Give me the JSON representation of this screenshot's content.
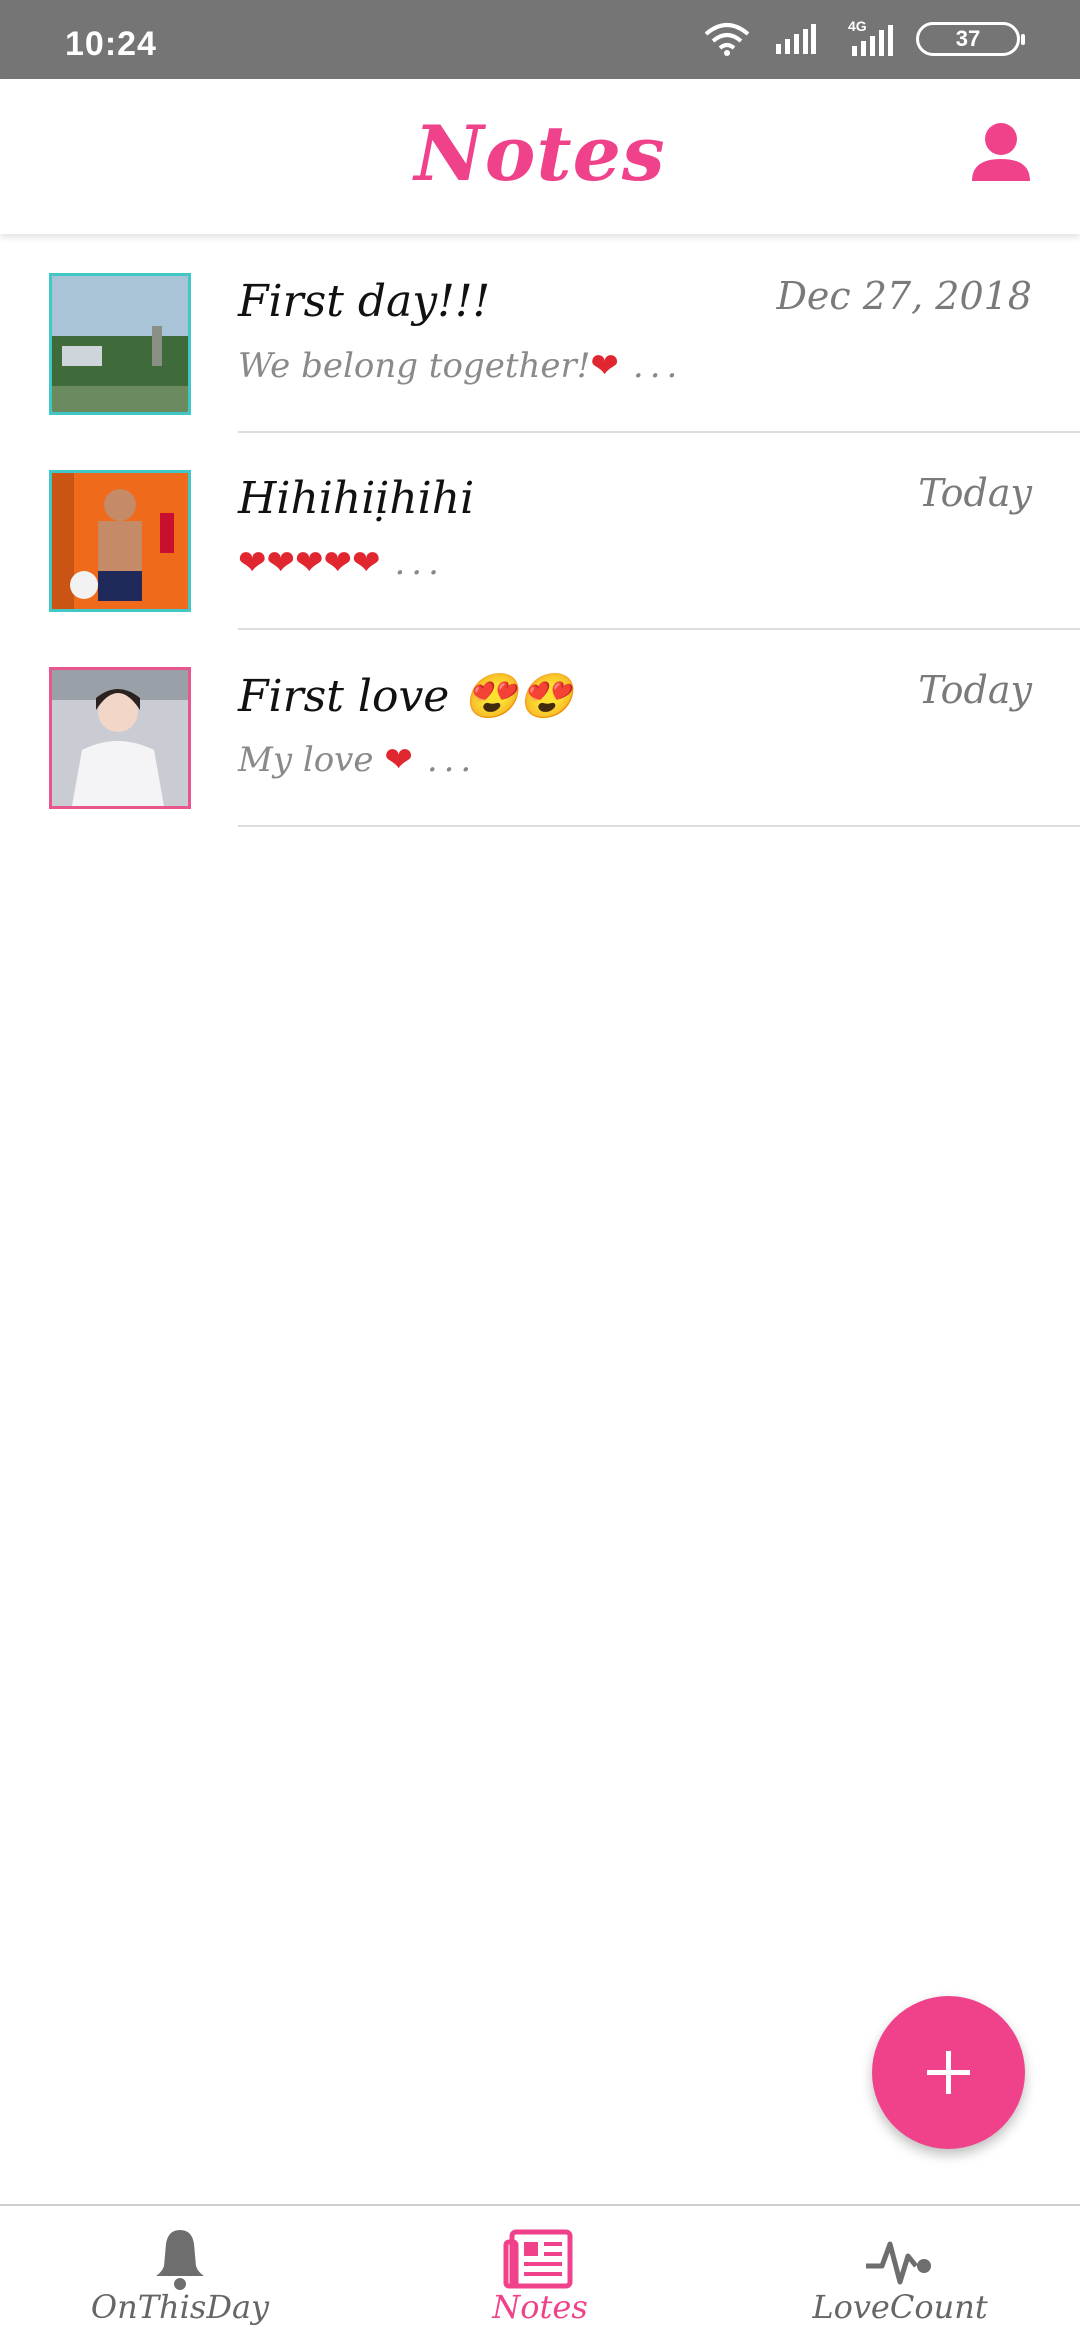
{
  "status_bar": {
    "time": "10:24",
    "network": "4G",
    "battery": "37"
  },
  "app_bar": {
    "title": "Notes"
  },
  "notes": [
    {
      "title": "First day!!!",
      "date": "Dec 27, 2018",
      "preview_text": "We belong together!",
      "preview_hearts": "❤",
      "ellipsis": "..."
    },
    {
      "title": "Hihihiịhihi",
      "date": "Today",
      "preview_text": "",
      "preview_hearts": "❤❤❤❤❤",
      "ellipsis": "..."
    },
    {
      "title": "First love 😍😍",
      "date": "Today",
      "preview_text": "My love ",
      "preview_hearts": "❤",
      "ellipsis": "..."
    }
  ],
  "fab": {
    "label": "+"
  },
  "bottom_nav": {
    "items": [
      {
        "label": "OnThisDay",
        "icon": "bell-icon",
        "active": false
      },
      {
        "label": "Notes",
        "icon": "newspaper-icon",
        "active": true
      },
      {
        "label": "LoveCount",
        "icon": "heartbeat-icon",
        "active": false
      }
    ]
  },
  "colors": {
    "accent": "#f0428a",
    "status_bar": "#757575",
    "thumb_border_teal": "#41c8c6",
    "thumb_border_pink": "#e8568e"
  }
}
